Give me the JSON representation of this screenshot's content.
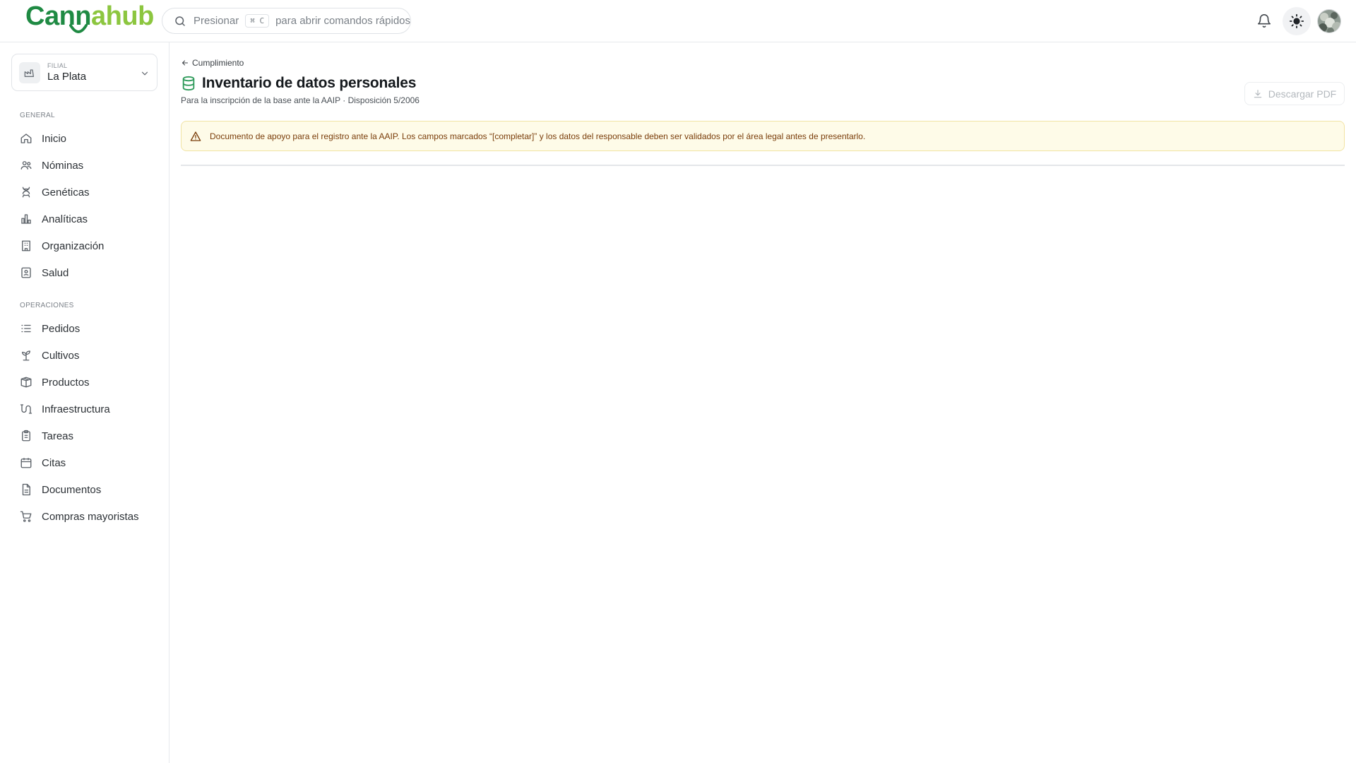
{
  "brand": {
    "part1": "Cann",
    "part2": "a",
    "part3": "hub"
  },
  "search": {
    "prefix": "Presionar",
    "shortcut": "⌘ C",
    "suffix": "para abrir comandos rápidos"
  },
  "branch": {
    "label": "FILIAL",
    "value": "La Plata"
  },
  "sidebar": {
    "sections": [
      {
        "label": "GENERAL",
        "items": [
          {
            "label": "Inicio",
            "icon": "home-icon"
          },
          {
            "label": "Nóminas",
            "icon": "users-icon"
          },
          {
            "label": "Genéticas",
            "icon": "dna-icon"
          },
          {
            "label": "Analíticas",
            "icon": "bar-chart-icon"
          },
          {
            "label": "Organización",
            "icon": "building-icon"
          },
          {
            "label": "Salud",
            "icon": "health-card-icon"
          }
        ]
      },
      {
        "label": "OPERACIONES",
        "items": [
          {
            "label": "Pedidos",
            "icon": "list-icon"
          },
          {
            "label": "Cultivos",
            "icon": "sprout-icon"
          },
          {
            "label": "Productos",
            "icon": "package-icon"
          },
          {
            "label": "Infraestructura",
            "icon": "pipeline-icon"
          },
          {
            "label": "Tareas",
            "icon": "clipboard-icon"
          },
          {
            "label": "Citas",
            "icon": "calendar-icon"
          },
          {
            "label": "Documentos",
            "icon": "document-icon"
          },
          {
            "label": "Compras mayoristas",
            "icon": "cart-icon"
          }
        ]
      }
    ]
  },
  "page": {
    "breadcrumb": "Cumplimiento",
    "title": "Inventario de datos personales",
    "subtitle": "Para la inscripción de la base ante la AAIP · Disposición 5/2006",
    "download_label": "Descargar PDF",
    "alert": "Documento de apoyo para el registro ante la AAIP. Los campos marcados “[completar]” y los datos del responsable deben ser validados por el área legal antes de presentarlo."
  },
  "colors": {
    "brand_dark": "#1f8a43",
    "brand_light": "#8cc63f",
    "alert_bg": "#fefbe8",
    "alert_border": "#f1e3a3",
    "alert_text": "#7a3d0a",
    "title_icon": "#2e9a5a"
  }
}
